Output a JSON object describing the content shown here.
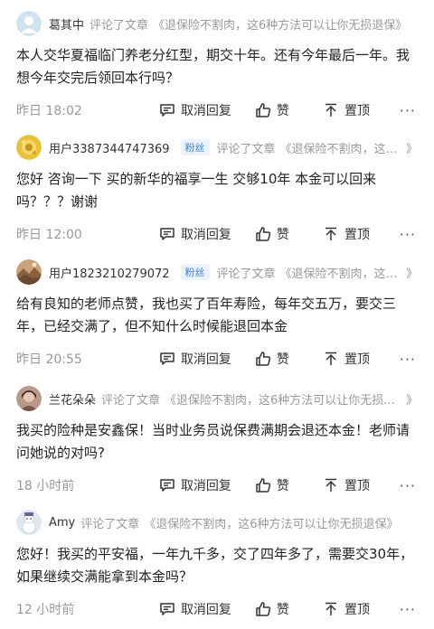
{
  "comments": [
    {
      "user": "葛其中",
      "fan_badge": "",
      "action": "评论了文章",
      "article": "《退保险不割肉，这6种方法可以让你无损退保》",
      "arrow": "",
      "text": "本人交华夏福临门养老分红型，期交十年。还有今年最后一年。我想今年交完后领回本行吗？",
      "time": "昨日 18:02",
      "reply_label": "取消回复",
      "like_label": "赞",
      "top_label": "置顶",
      "more": "···",
      "avatar_icon": "default-avatar-icon"
    },
    {
      "user": "用户3387344747369",
      "fan_badge": "粉丝",
      "action": "评论了文章",
      "article": "《退保险不割肉，这6...",
      "arrow": "》",
      "text": "您好 咨询一下 买的新华的福享一生 交够10年 本金可以回来吗？？？谢谢",
      "time": "昨日 12:00",
      "reply_label": "取消回复",
      "like_label": "赞",
      "top_label": "置顶",
      "more": "···",
      "avatar_icon": "yellow-flower-avatar-icon"
    },
    {
      "user": "用户1823210279072",
      "fan_badge": "粉丝",
      "action": "评论了文章",
      "article": "《退保险不割肉，这6...",
      "arrow": "》",
      "text": "给有良知的老师点赞，我也买了百年寿险，每年交五万，要交三年，已经交满了，但不知什么时候能退回本金",
      "time": "昨日 20:55",
      "reply_label": "取消回复",
      "like_label": "赞",
      "top_label": "置顶",
      "more": "···",
      "avatar_icon": "landscape-avatar-icon"
    },
    {
      "user": "兰花朵朵",
      "fan_badge": "",
      "action": "评论了文章",
      "article": "《退保险不割肉，这6种方法可以让你无损...",
      "arrow": "》",
      "text": "我买的险种是安鑫保！当时业务员说保费满期会退还本金！老师请问她说的对吗?",
      "time": "18 小时前",
      "reply_label": "取消回复",
      "like_label": "赞",
      "top_label": "置顶",
      "more": "···",
      "avatar_icon": "portrait-avatar-icon"
    },
    {
      "user": "Amy",
      "fan_badge": "",
      "action": "评论了文章",
      "article": "《退保险不割肉，这6种方法可以让你无损退保》",
      "arrow": "",
      "text": "您好！我买的平安福，一年九千多，交了四年多了，需要交30年，如果继续交满能拿到本金吗？",
      "time": "12 小时前",
      "reply_label": "取消回复",
      "like_label": "赞",
      "top_label": "置顶",
      "more": "···",
      "avatar_icon": "snowman-avatar-icon"
    }
  ]
}
